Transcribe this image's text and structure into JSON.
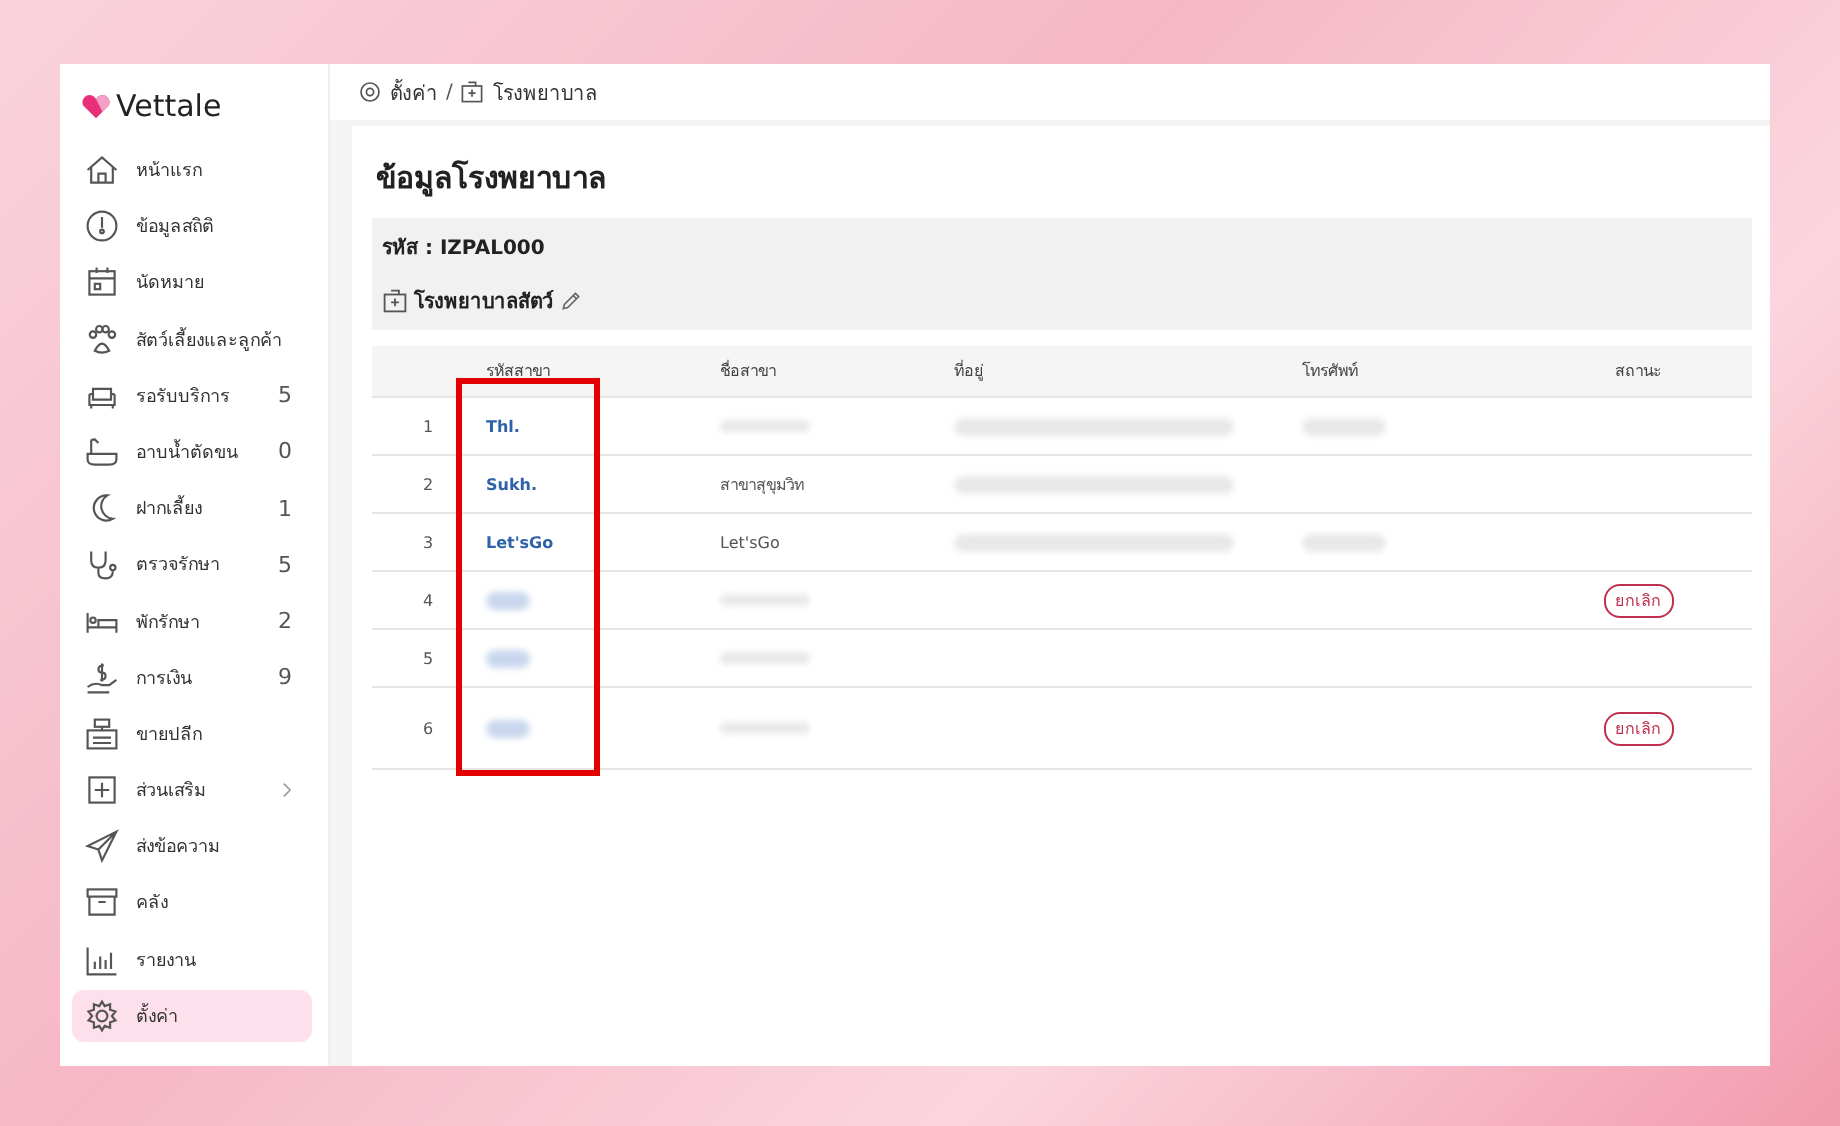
{
  "logo": {
    "text": "Vettale"
  },
  "sidebar": {
    "items": [
      {
        "label": "หน้าแรก",
        "selected": false
      },
      {
        "label": "ข้อมูลสถิติ",
        "selected": false
      },
      {
        "label": "นัดหมาย",
        "selected": false
      },
      {
        "label": "สัตว์เลี้ยงและลูกค้า",
        "selected": false
      },
      {
        "label": "รอรับบริการ",
        "count": "5",
        "selected": false
      },
      {
        "label": "อาบน้ำตัดขน",
        "count": "0",
        "selected": false
      },
      {
        "label": "ฝากเลี้ยง",
        "count": "1",
        "selected": false
      },
      {
        "label": "ตรวจรักษา",
        "count": "5",
        "selected": false
      },
      {
        "label": "พักรักษา",
        "count": "2",
        "selected": false
      },
      {
        "label": "การเงิน",
        "count": "9",
        "selected": false
      },
      {
        "label": "ขายปลีก",
        "selected": false
      },
      {
        "label": "ส่วนเสริม",
        "expandable": true,
        "selected": false
      },
      {
        "label": "ส่งข้อความ",
        "selected": false
      },
      {
        "label": "คลัง",
        "selected": false
      },
      {
        "label": "รายงาน",
        "selected": false
      },
      {
        "label": "ตั้งค่า",
        "selected": true
      }
    ]
  },
  "breadcrumb": [
    {
      "label": "ตั้งค่า"
    },
    {
      "label": "โรงพยาบาล"
    }
  ],
  "breadcrumb_separator": "/",
  "page_title": "ข้อมูลโรงพยาบาล",
  "info": {
    "code": "รหัส : IZPAL000",
    "name": "โรงพยาบาลสัตว์"
  },
  "table": {
    "columns": [
      "",
      "รหัสสาขา",
      "ชื่อสาขา",
      "ที่อยู่",
      "โทรศัพท์",
      "สถานะ"
    ],
    "rows": [
      {
        "index": "1",
        "code": "Thl.",
        "name_hidden": true,
        "address_hidden": true,
        "phone_hidden": true
      },
      {
        "index": "2",
        "code": "Sukh.",
        "name": "สาขาสุขุมวิท",
        "address_hidden": true
      },
      {
        "index": "3",
        "code": "Let'sGo",
        "name": "Let'sGo",
        "address_hidden": true,
        "phone_hidden": true
      },
      {
        "index": "4",
        "code_hidden": true,
        "name_hidden": true,
        "status": "ยกเลิก"
      },
      {
        "index": "5",
        "code_hidden": true,
        "name_hidden": true
      },
      {
        "index": "6",
        "code_hidden": true,
        "name_hidden": true,
        "status": "ยกเลิก"
      }
    ]
  }
}
